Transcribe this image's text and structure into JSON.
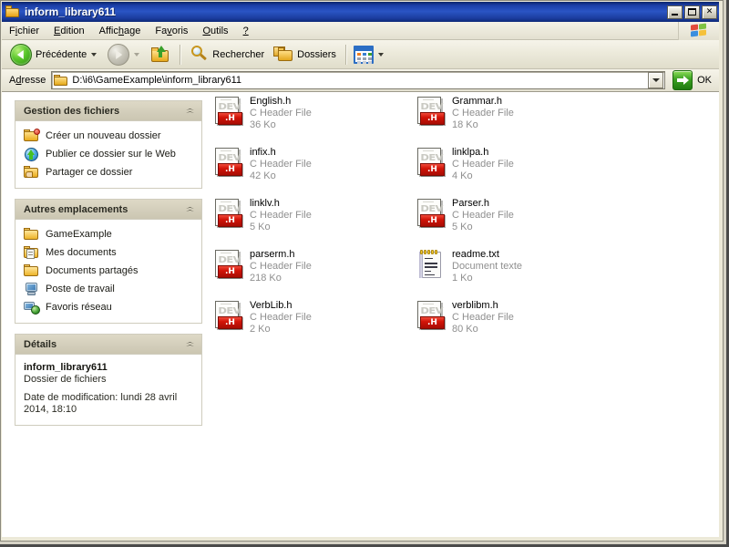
{
  "window": {
    "title": "inform_library611",
    "title_icon": "folder-icon",
    "buttons": {
      "minimize": "minimize-button",
      "maximize": "maximize-button",
      "close": "✕"
    }
  },
  "menubar": {
    "items": [
      {
        "pre": "F",
        "accel": "i",
        "post": "chier"
      },
      {
        "pre": "",
        "accel": "E",
        "post": "dition"
      },
      {
        "pre": "Affic",
        "accel": "h",
        "post": "age"
      },
      {
        "pre": "Fa",
        "accel": "v",
        "post": "oris"
      },
      {
        "pre": "",
        "accel": "O",
        "post": "utils"
      },
      {
        "pre": "",
        "accel": "?",
        "post": ""
      }
    ],
    "logo": "windows-flag-icon"
  },
  "toolbar": {
    "back_label": "Précédente",
    "forward_label": "",
    "up_label": "",
    "search_label": "Rechercher",
    "folders_label": "Dossiers",
    "views_label": ""
  },
  "address": {
    "label_pre": "A",
    "label_accel": "d",
    "label_post": "resse",
    "value": "D:\\i6\\GameExample\\inform_library611",
    "go_label": "OK"
  },
  "sidebar": {
    "panels": [
      {
        "title": "Gestion des fichiers",
        "type": "links",
        "items": [
          {
            "label": "Créer un nouveau dossier",
            "icon": "new-folder-icon"
          },
          {
            "label": "Publier ce dossier sur le Web",
            "icon": "publish-web-icon"
          },
          {
            "label": "Partager ce dossier",
            "icon": "share-folder-icon"
          }
        ]
      },
      {
        "title": "Autres emplacements",
        "type": "links",
        "items": [
          {
            "label": "GameExample",
            "icon": "folder-icon"
          },
          {
            "label": "Mes documents",
            "icon": "my-documents-icon"
          },
          {
            "label": "Documents partagés",
            "icon": "folder-icon"
          },
          {
            "label": "Poste de travail",
            "icon": "my-computer-icon"
          },
          {
            "label": "Favoris réseau",
            "icon": "network-places-icon"
          }
        ]
      },
      {
        "title": "Détails",
        "type": "details",
        "name": "inform_library611",
        "kind": "Dossier de fichiers",
        "date": "Date de modification: lundi 28 avril 2014, 18:10"
      }
    ]
  },
  "files": [
    {
      "name": "English.h",
      "type": "C Header File",
      "size": "36 Ko",
      "icon": "header-file-icon",
      "badge": ".H"
    },
    {
      "name": "Grammar.h",
      "type": "C Header File",
      "size": "18 Ko",
      "icon": "header-file-icon",
      "badge": ".H"
    },
    {
      "name": "infix.h",
      "type": "C Header File",
      "size": "42 Ko",
      "icon": "header-file-icon",
      "badge": ".H"
    },
    {
      "name": "linklpa.h",
      "type": "C Header File",
      "size": "4 Ko",
      "icon": "header-file-icon",
      "badge": ".H"
    },
    {
      "name": "linklv.h",
      "type": "C Header File",
      "size": "5 Ko",
      "icon": "header-file-icon",
      "badge": ".H"
    },
    {
      "name": "Parser.h",
      "type": "C Header File",
      "size": "5 Ko",
      "icon": "header-file-icon",
      "badge": ".H"
    },
    {
      "name": "parserm.h",
      "type": "C Header File",
      "size": "218 Ko",
      "icon": "header-file-icon",
      "badge": ".H"
    },
    {
      "name": "readme.txt",
      "type": "Document texte",
      "size": "1 Ko",
      "icon": "text-document-icon",
      "badge": ""
    },
    {
      "name": "VerbLib.h",
      "type": "C Header File",
      "size": "2 Ko",
      "icon": "header-file-icon",
      "badge": ".H"
    },
    {
      "name": "verblibm.h",
      "type": "C Header File",
      "size": "80 Ko",
      "icon": "header-file-icon",
      "badge": ".H"
    }
  ],
  "colors": {
    "titlebar": "#1c3fa8",
    "chrome": "#ece9d8",
    "panel_header": "#d6d1be",
    "accent_green": "#3aa021",
    "badge_red": "#d21408",
    "muted_text": "#8f8f8f"
  }
}
